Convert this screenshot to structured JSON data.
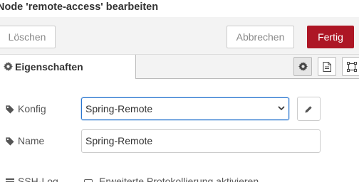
{
  "dialog": {
    "title": "Node 'remote-access' bearbeiten"
  },
  "toolbar": {
    "delete_label": "Löschen",
    "cancel_label": "Abbrechen",
    "done_label": "Fertig"
  },
  "tabs": {
    "properties_label": "Eigenschaften",
    "icons": [
      "gear-icon",
      "description-icon",
      "appearance-icon"
    ]
  },
  "form": {
    "config_label": "Konfig",
    "config_value": "Spring-Remote",
    "name_label": "Name",
    "name_value": "Spring-Remote",
    "ssh_label": "SSH-Log",
    "ssh_checkbox_label": "Erweiterte Protokollierung aktivieren"
  },
  "colors": {
    "primary_button": "#ad1625",
    "focus_border": "#2a76cf",
    "toolbar_bg": "#f3f3f3"
  }
}
